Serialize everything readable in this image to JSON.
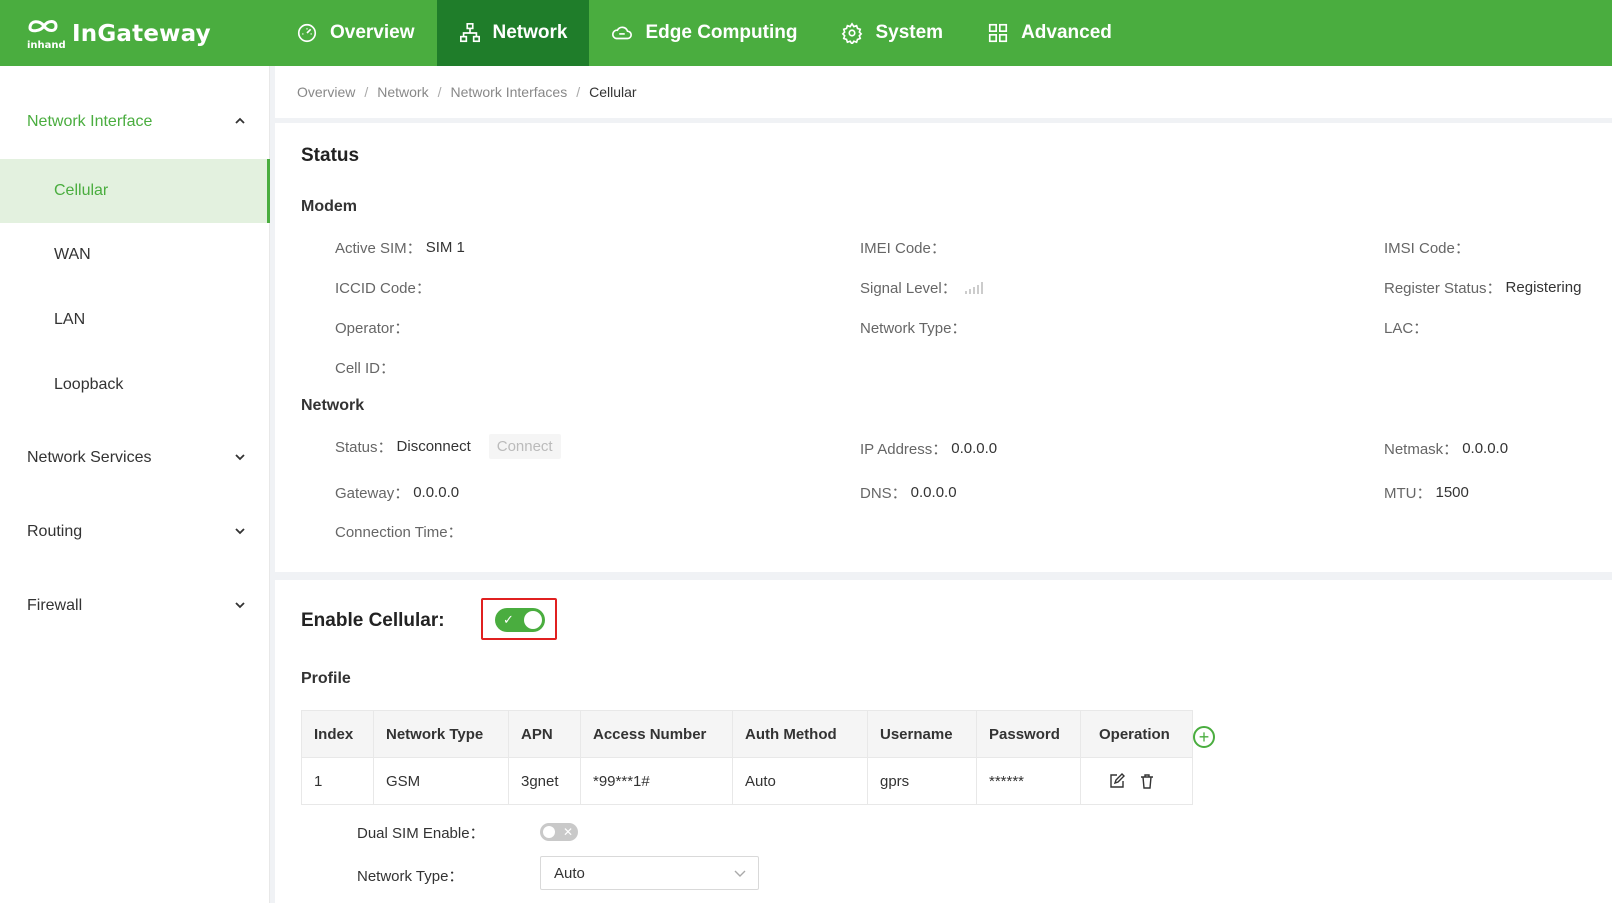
{
  "brand": {
    "logo_small": "inhand",
    "name": "InGateway"
  },
  "nav": [
    {
      "label": "Overview",
      "icon": "dashboard-icon"
    },
    {
      "label": "Network",
      "icon": "network-icon",
      "active": true
    },
    {
      "label": "Edge Computing",
      "icon": "cloud-icon"
    },
    {
      "label": "System",
      "icon": "gear-icon"
    },
    {
      "label": "Advanced",
      "icon": "grid-icon"
    }
  ],
  "sidebar": {
    "network_interface": "Network Interface",
    "items": [
      "Cellular",
      "WAN",
      "LAN",
      "Loopback"
    ],
    "network_services": "Network Services",
    "routing": "Routing",
    "firewall": "Firewall"
  },
  "breadcrumb": [
    "Overview",
    "Network",
    "Network Interfaces",
    "Cellular"
  ],
  "status": {
    "title": "Status",
    "modem_title": "Modem",
    "active_sim_label": "Active SIM：",
    "active_sim_value": "SIM 1",
    "imei_label": "IMEI Code：",
    "imsi_label": "IMSI Code：",
    "iccid_label": "ICCID Code：",
    "signal_label": "Signal Level：",
    "register_label": "Register Status：",
    "register_value": "Registering",
    "operator_label": "Operator：",
    "network_type_label": "Network Type：",
    "lac_label": "LAC：",
    "cell_id_label": "Cell ID：",
    "network_title": "Network",
    "status_label": "Status：",
    "status_value": "Disconnect",
    "connect_button": "Connect",
    "ip_label": "IP Address：",
    "ip_value": "0.0.0.0",
    "netmask_label": "Netmask：",
    "netmask_value": "0.0.0.0",
    "gateway_label": "Gateway：",
    "gateway_value": "0.0.0.0",
    "dns_label": "DNS：",
    "dns_value": "0.0.0.0",
    "mtu_label": "MTU：",
    "mtu_value": "1500",
    "conn_time_label": "Connection Time："
  },
  "config": {
    "enable_label": "Enable Cellular:",
    "enable_state": true,
    "profile_title": "Profile",
    "table_headers": [
      "Index",
      "Network Type",
      "APN",
      "Access Number",
      "Auth Method",
      "Username",
      "Password",
      "Operation"
    ],
    "rows": [
      {
        "index": "1",
        "network_type": "GSM",
        "apn": "3gnet",
        "access_number": "*99***1#",
        "auth_method": "Auto",
        "username": "gprs",
        "password": "******"
      }
    ],
    "dual_sim_label": "Dual SIM Enable：",
    "dual_sim_state": false,
    "network_type_label": "Network Type：",
    "network_type_value": "Auto"
  },
  "colors": {
    "brand_green": "#4aad3f",
    "nav_active": "#1f7d2a",
    "highlight_red": "#e02020"
  }
}
